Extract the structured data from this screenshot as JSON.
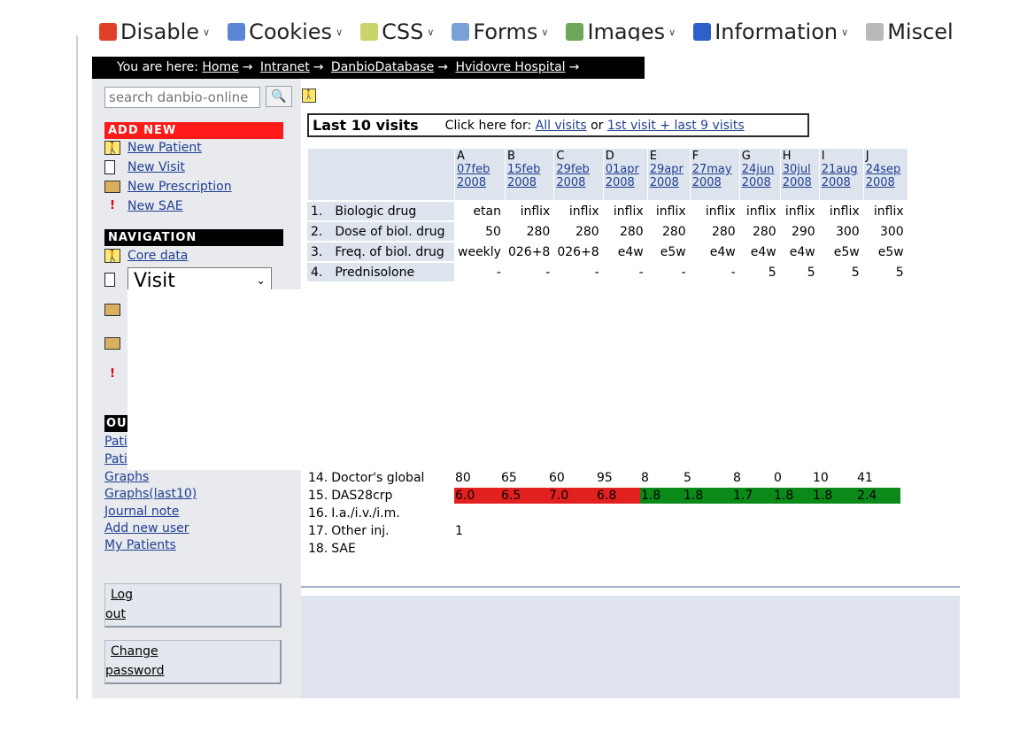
{
  "devbar": {
    "items": [
      {
        "label": "Disable",
        "icon": "disable-icon",
        "color": "#e0402a"
      },
      {
        "label": "Cookies",
        "icon": "cookies-icon",
        "color": "#5b86d6"
      },
      {
        "label": "CSS",
        "icon": "css-icon",
        "color": "#c9d46a"
      },
      {
        "label": "Forms",
        "icon": "forms-icon",
        "color": "#7aa0d6"
      },
      {
        "label": "Images",
        "icon": "images-icon",
        "color": "#6ea65a"
      },
      {
        "label": "Information",
        "icon": "information-icon",
        "color": "#2f5fc8"
      },
      {
        "label": "Miscel",
        "icon": "miscellaneous-icon",
        "color": "#b9b9b9"
      }
    ]
  },
  "breadcrumb": {
    "prefix": "You are here:",
    "items": [
      "Home",
      "Intranet",
      "DanbioDatabase",
      "Hvidovre Hospital"
    ],
    "separator": "→"
  },
  "sidebar": {
    "search_placeholder": "search danbio-online",
    "add_new_title": "ADD NEW",
    "add_new_items": [
      {
        "label": "New Patient",
        "icon": "person-icon"
      },
      {
        "label": "New Visit",
        "icon": "document-icon"
      },
      {
        "label": "New Prescription",
        "icon": "folder-icon"
      },
      {
        "label": "New SAE",
        "icon": "exclamation-icon"
      }
    ],
    "navigation_title": "NAVIGATION",
    "nav_core": "Core data",
    "visit_select": "Visit",
    "out_title": "OU",
    "out_links_partial": [
      "Pati",
      "Pati"
    ],
    "out_links": [
      "Graphs",
      "Graphs(last10)",
      "Journal note",
      "Add new user",
      "My Patients"
    ],
    "logout": [
      "Log",
      "out"
    ],
    "change_password": [
      "Change",
      "password"
    ]
  },
  "main": {
    "title": "Last 10 visits",
    "subtitle_prefix": "Click here for:",
    "all_visits": "All visits",
    "or": "or",
    "first_last": "1st visit + last 9 visits",
    "colors": {
      "bad": "#e32020",
      "good": "#0b8a1a",
      "label_bg": "#dde4ee"
    },
    "visits": [
      {
        "letter": "A",
        "date": "07feb",
        "year": "2008"
      },
      {
        "letter": "B",
        "date": "15feb",
        "year": "2008"
      },
      {
        "letter": "C",
        "date": "29feb",
        "year": "2008"
      },
      {
        "letter": "D",
        "date": "01apr",
        "year": "2008"
      },
      {
        "letter": "E",
        "date": "29apr",
        "year": "2008"
      },
      {
        "letter": "F",
        "date": "27may",
        "year": "2008"
      },
      {
        "letter": "G",
        "date": "24jun",
        "year": "2008"
      },
      {
        "letter": "H",
        "date": "30jul",
        "year": "2008"
      },
      {
        "letter": "I",
        "date": "21aug",
        "year": "2008"
      },
      {
        "letter": "J",
        "date": "24sep",
        "year": "2008"
      }
    ],
    "rows_top": [
      {
        "num": "1.",
        "label": "Biologic drug",
        "values": [
          "etan",
          "inflix",
          "inflix",
          "inflix",
          "inflix",
          "inflix",
          "inflix",
          "inflix",
          "inflix",
          "inflix"
        ]
      },
      {
        "num": "2.",
        "label": "Dose of biol. drug",
        "values": [
          "50",
          "280",
          "280",
          "280",
          "280",
          "280",
          "280",
          "290",
          "300",
          "300"
        ]
      },
      {
        "num": "3.",
        "label": "Freq. of biol. drug",
        "values": [
          "weekly",
          "026+8",
          "026+8",
          "e4w",
          "e5w",
          "e4w",
          "e4w",
          "e4w",
          "e5w",
          "e5w"
        ]
      },
      {
        "num": "4.",
        "label": "Prednisolone",
        "values": [
          "-",
          "-",
          "-",
          "-",
          "-",
          "-",
          "5",
          "5",
          "5",
          "5"
        ]
      }
    ],
    "rows_bottom": [
      {
        "num": "14.",
        "label": "Doctor's global",
        "values": [
          "80",
          "65",
          "60",
          "95",
          "8",
          "5",
          "8",
          "0",
          "10",
          "41"
        ],
        "kind": "plain"
      },
      {
        "num": "15.",
        "label": "DAS28crp",
        "values": [
          "6.0",
          "6.5",
          "7.0",
          "6.8",
          "1.8",
          "1.8",
          "1.7",
          "1.8",
          "1.8",
          "2.4"
        ],
        "kind": "das",
        "status": [
          "bad",
          "bad",
          "bad",
          "bad",
          "good",
          "good",
          "good",
          "good",
          "good",
          "good"
        ]
      },
      {
        "num": "16.",
        "label": "I.a./i.v./i.m.",
        "values": [
          "",
          "",
          "",
          "",
          "",
          "",
          "",
          "",
          "",
          ""
        ],
        "kind": "blank"
      },
      {
        "num": "17.",
        "label": "Other inj.",
        "values": [
          "1",
          "",
          "",
          "",
          "",
          "",
          "",
          "",
          "",
          ""
        ],
        "kind": "blank"
      },
      {
        "num": "18.",
        "label": "SAE",
        "values": [
          "",
          "",
          "",
          "",
          "",
          "",
          "",
          "",
          "",
          ""
        ],
        "kind": "blank"
      }
    ]
  }
}
